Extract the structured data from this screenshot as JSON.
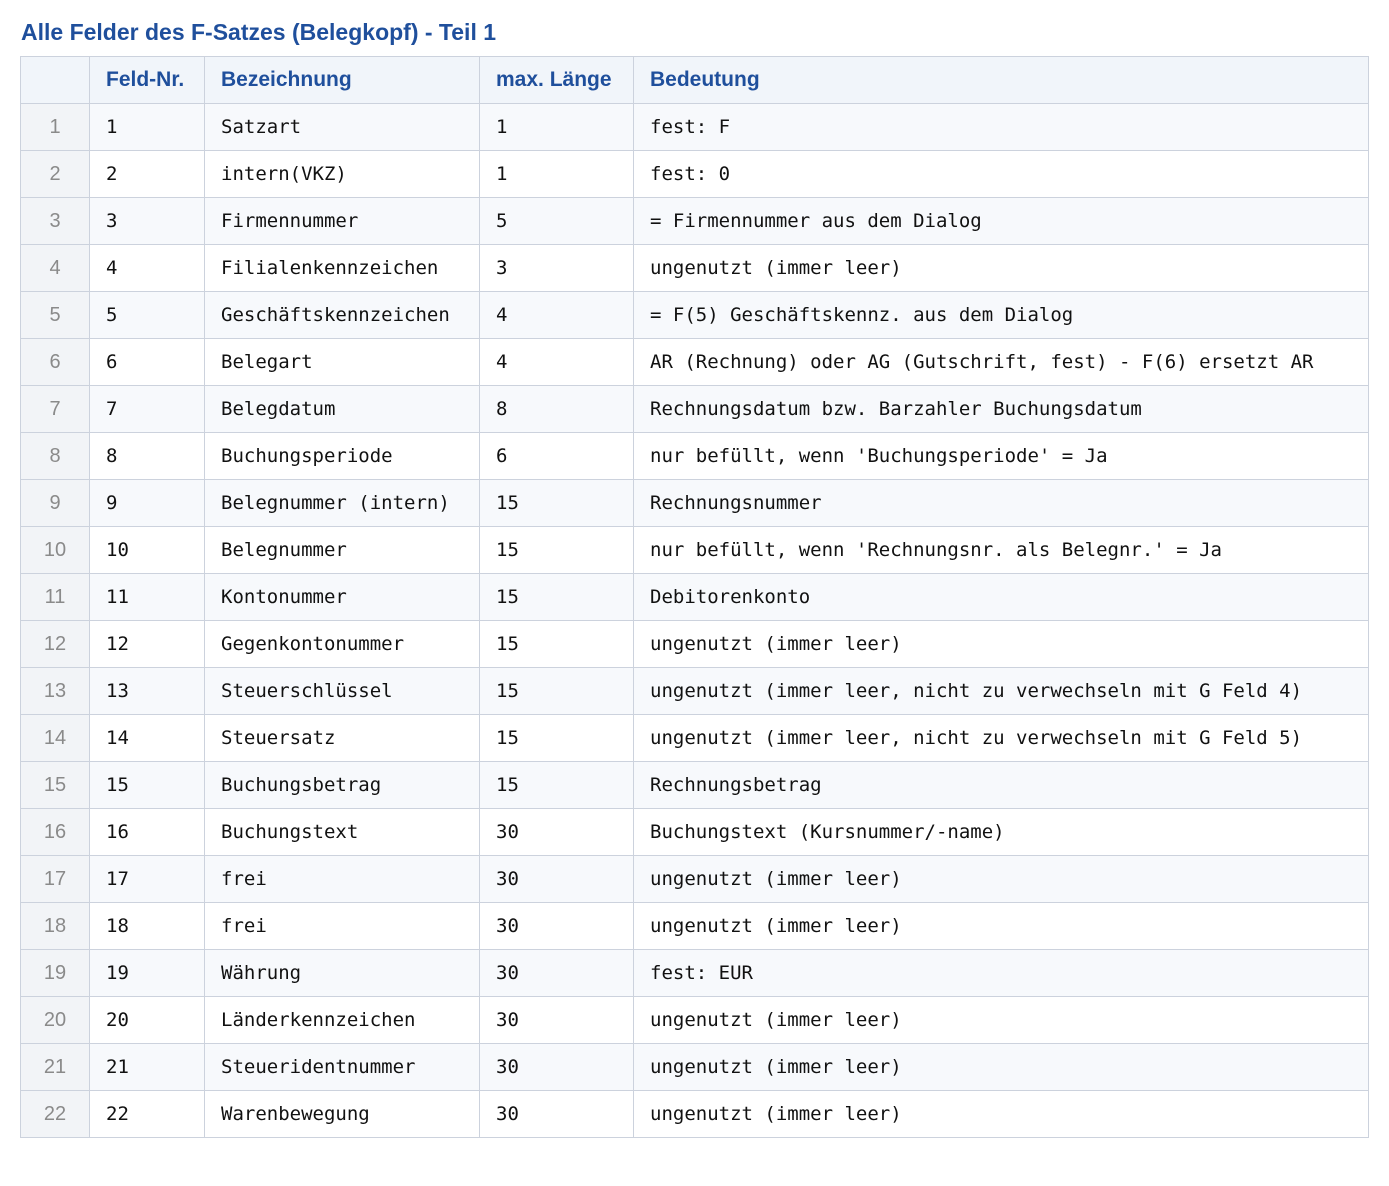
{
  "title": "Alle Felder des F-Satzes (Belegkopf) - Teil 1",
  "columns": {
    "index": "",
    "feld_nr": "Feld-Nr.",
    "bezeichnung": "Bezeichnung",
    "max_laenge": "max. Länge",
    "bedeutung": "Bedeutung"
  },
  "rows": [
    {
      "idx": "1",
      "nr": "1",
      "bez": "Satzart",
      "len": "1",
      "bed": "fest: F"
    },
    {
      "idx": "2",
      "nr": "2",
      "bez": "intern(VKZ)",
      "len": "1",
      "bed": "fest: 0"
    },
    {
      "idx": "3",
      "nr": "3",
      "bez": "Firmennummer",
      "len": "5",
      "bed": "= Firmennummer aus dem Dialog"
    },
    {
      "idx": "4",
      "nr": "4",
      "bez": "Filialenkennzeichen",
      "len": "3",
      "bed": "ungenutzt (immer leer)"
    },
    {
      "idx": "5",
      "nr": "5",
      "bez": "Geschäftskennzeichen",
      "len": "4",
      "bed": "= F(5) Geschäftskennz. aus dem Dialog"
    },
    {
      "idx": "6",
      "nr": "6",
      "bez": "Belegart",
      "len": "4",
      "bed": "AR (Rechnung) oder AG (Gutschrift, fest) - F(6) ersetzt AR"
    },
    {
      "idx": "7",
      "nr": "7",
      "bez": "Belegdatum",
      "len": "8",
      "bed": "Rechnungsdatum bzw. Barzahler Buchungsdatum"
    },
    {
      "idx": "8",
      "nr": "8",
      "bez": "Buchungsperiode",
      "len": "6",
      "bed": "nur befüllt, wenn 'Buchungsperiode' = Ja"
    },
    {
      "idx": "9",
      "nr": "9",
      "bez": "Belegnummer (intern)",
      "len": "15",
      "bed": "Rechnungsnummer"
    },
    {
      "idx": "10",
      "nr": "10",
      "bez": "Belegnummer",
      "len": "15",
      "bed": "nur befüllt, wenn 'Rechnungsnr. als Belegnr.' = Ja"
    },
    {
      "idx": "11",
      "nr": "11",
      "bez": "Kontonummer",
      "len": "15",
      "bed": "Debitorenkonto"
    },
    {
      "idx": "12",
      "nr": "12",
      "bez": "Gegenkontonummer",
      "len": "15",
      "bed": "ungenutzt (immer leer)"
    },
    {
      "idx": "13",
      "nr": "13",
      "bez": "Steuerschlüssel",
      "len": "15",
      "bed": "ungenutzt (immer leer, nicht zu verwechseln mit G Feld 4)"
    },
    {
      "idx": "14",
      "nr": "14",
      "bez": "Steuersatz",
      "len": "15",
      "bed": "ungenutzt (immer leer, nicht zu verwechseln mit G Feld 5)"
    },
    {
      "idx": "15",
      "nr": "15",
      "bez": "Buchungsbetrag",
      "len": "15",
      "bed": "Rechnungsbetrag"
    },
    {
      "idx": "16",
      "nr": "16",
      "bez": "Buchungstext",
      "len": "30",
      "bed": "Buchungstext (Kursnummer/-name)"
    },
    {
      "idx": "17",
      "nr": "17",
      "bez": "frei",
      "len": "30",
      "bed": "ungenutzt (immer leer)"
    },
    {
      "idx": "18",
      "nr": "18",
      "bez": "frei",
      "len": "30",
      "bed": "ungenutzt (immer leer)"
    },
    {
      "idx": "19",
      "nr": "19",
      "bez": "Währung",
      "len": "30",
      "bed": "fest: EUR"
    },
    {
      "idx": "20",
      "nr": "20",
      "bez": "Länderkennzeichen",
      "len": "30",
      "bed": "ungenutzt (immer leer)"
    },
    {
      "idx": "21",
      "nr": "21",
      "bez": "Steueridentnummer",
      "len": "30",
      "bed": "ungenutzt (immer leer)"
    },
    {
      "idx": "22",
      "nr": "22",
      "bez": "Warenbewegung",
      "len": "30",
      "bed": "ungenutzt (immer leer)"
    }
  ]
}
